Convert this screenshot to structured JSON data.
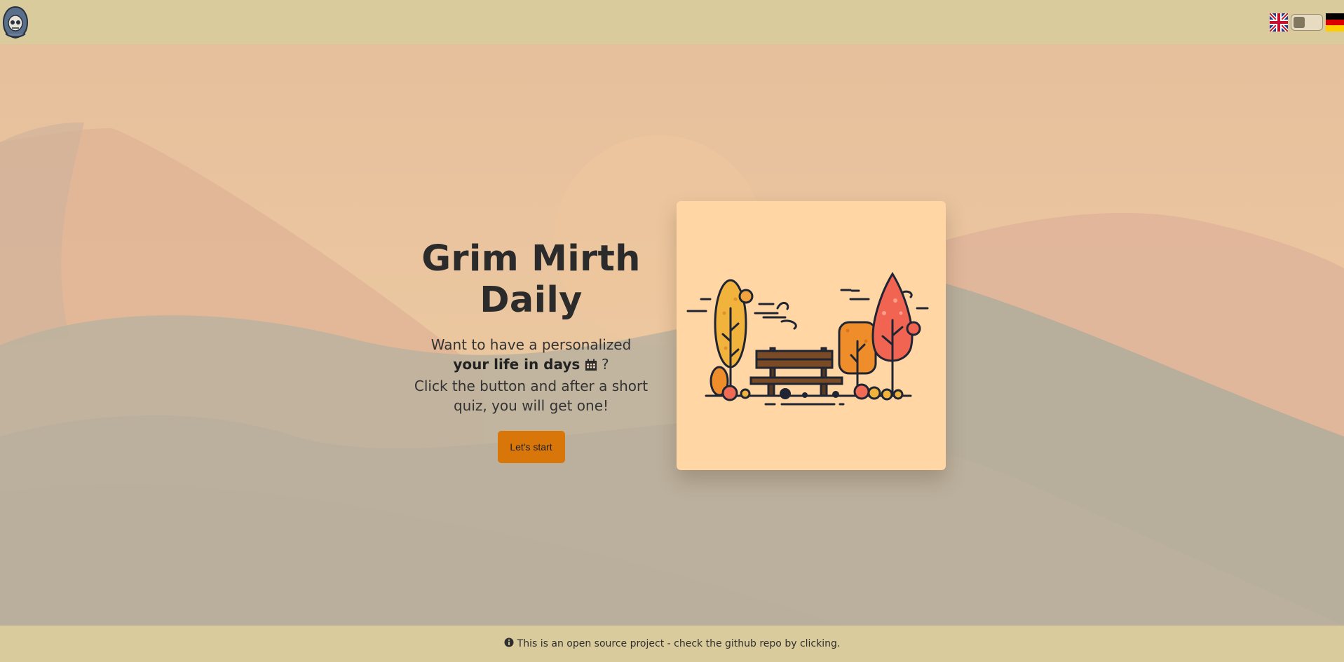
{
  "header": {
    "logo_icon": "grim-reaper-skull-icon",
    "languages": [
      {
        "code": "en",
        "icon": "uk-flag-icon"
      },
      {
        "code": "de",
        "icon": "germany-flag-icon"
      }
    ],
    "theme_toggle_icon": "theme-toggle"
  },
  "hero": {
    "title": "Grim Mirth Daily",
    "line1": "Want to have a personalized",
    "line2_bold": "your life in days",
    "line2_icon": "calendar-icon",
    "line2_suffix": " ?",
    "line3": "Click the button and after a short",
    "line4": "quiz, you will get one!",
    "button_label": "Let's start"
  },
  "illustration": {
    "icon": "park-bench-autumn-trees-illustration"
  },
  "footer": {
    "icon": "info-icon",
    "text": "This is an open source project - check the github repo by clicking."
  },
  "colors": {
    "header_bg": "#d9cb9b",
    "accent": "#d9760a",
    "card_bg": "#ffd6a4",
    "text": "#2b2b2b"
  }
}
